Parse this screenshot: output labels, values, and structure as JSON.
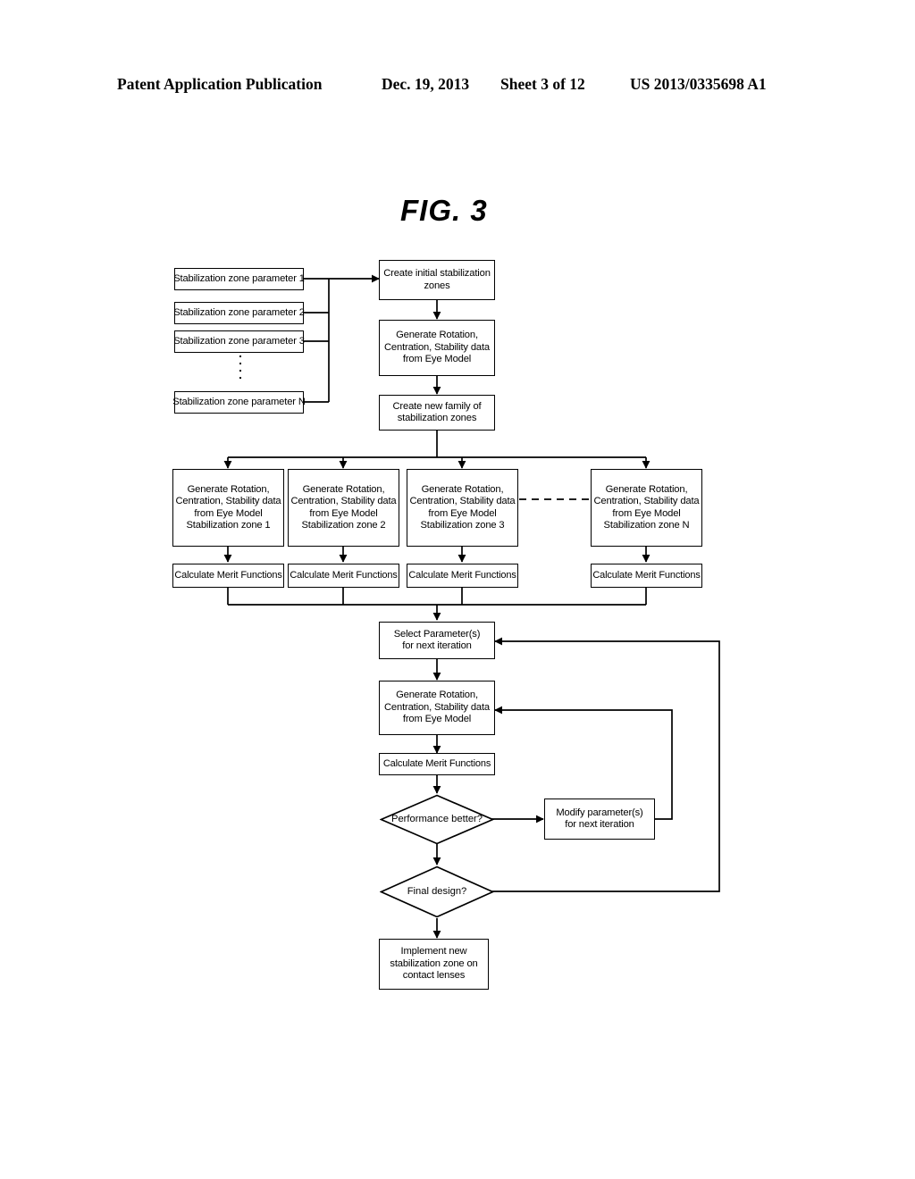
{
  "header": {
    "publication": "Patent Application Publication",
    "date": "Dec. 19, 2013",
    "sheet": "Sheet 3 of 12",
    "number": "US 2013/0335698 A1"
  },
  "figure": {
    "title": "FIG. 3"
  },
  "diagram": {
    "parameters": [
      {
        "label": "Stabilization zone parameter 1"
      },
      {
        "label": "Stabilization zone parameter 2"
      },
      {
        "label": "Stabilization zone parameter 3"
      },
      {
        "label": "Stabilization zone parameter N"
      }
    ],
    "init_chain": [
      {
        "lines": [
          "Create initial stabilization",
          "zones"
        ]
      },
      {
        "lines": [
          "Generate Rotation,",
          "Centration, Stability data",
          "from Eye Model"
        ]
      },
      {
        "lines": [
          "Create new family of",
          "stabilization zones"
        ]
      }
    ],
    "branches": [
      {
        "generate": {
          "lines": [
            "Generate Rotation,",
            "Centration, Stability data",
            "from Eye Model",
            "Stabilization zone 1"
          ]
        },
        "merit": "Calculate Merit Functions"
      },
      {
        "generate": {
          "lines": [
            "Generate Rotation,",
            "Centration, Stability data",
            "from Eye Model",
            "Stabilization zone 2"
          ]
        },
        "merit": "Calculate Merit Functions"
      },
      {
        "generate": {
          "lines": [
            "Generate Rotation,",
            "Centration, Stability data",
            "from Eye Model",
            "Stabilization zone 3"
          ]
        },
        "merit": "Calculate Merit Functions"
      },
      {
        "generate": {
          "lines": [
            "Generate Rotation,",
            "Centration, Stability data",
            "from Eye Model",
            "Stabilization zone N"
          ]
        },
        "merit": "Calculate Merit Functions"
      }
    ],
    "iteration": {
      "select": {
        "lines": [
          "Select Parameter(s)",
          "for next iteration"
        ]
      },
      "generate": {
        "lines": [
          "Generate Rotation,",
          "Centration, Stability data",
          "from Eye Model"
        ]
      },
      "merit": "Calculate Merit Functions",
      "performance_decision": {
        "lines": [
          "Performance",
          "better?"
        ]
      },
      "modify": {
        "lines": [
          "Modify parameter(s)",
          "for next iteration"
        ]
      },
      "final_decision": {
        "lines": [
          "Final design?"
        ]
      },
      "implement": {
        "lines": [
          "Implement new",
          "stabilization zone on",
          "contact lenses"
        ]
      }
    }
  },
  "style": {
    "ink": "#000000",
    "paper": "#ffffff"
  }
}
